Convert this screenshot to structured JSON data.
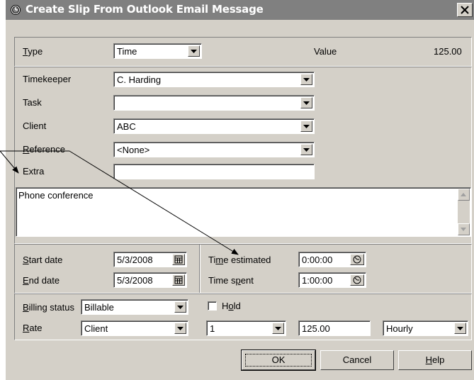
{
  "window": {
    "title": "Create Slip From Outlook Email Message"
  },
  "header": {
    "type_label": "Type",
    "type_value": "Time",
    "value_label": "Value",
    "value_amount": "125.00"
  },
  "fields": {
    "timekeeper_label": "Timekeeper",
    "timekeeper_value": "C. Harding",
    "task_label": "Task",
    "task_value": "",
    "client_label": "Client",
    "client_value": "ABC",
    "reference_label": "Reference",
    "reference_value": "<None>",
    "extra_label": "Extra",
    "extra_value": ""
  },
  "description": "Phone conference",
  "dates": {
    "start_label": "Start date",
    "start_value": "5/3/2008",
    "end_label": "End date",
    "end_value": "5/3/2008",
    "estimated_label": "Time estimated",
    "estimated_value": "0:00:00",
    "spent_label": "Time spent",
    "spent_value": "1:00:00"
  },
  "billing": {
    "status_label": "Billing status",
    "status_value": "Billable",
    "hold_label": "Hold",
    "hold_checked": false,
    "rate_label": "Rate",
    "rate_source": "Client",
    "rate_level": "1",
    "rate_amount": "125.00",
    "rate_unit": "Hourly"
  },
  "buttons": {
    "ok": "OK",
    "cancel": "Cancel",
    "help": "Help"
  },
  "icons": [
    "clock-icon",
    "close-icon",
    "dropdown-arrow-icon",
    "calendar-icon",
    "timer-icon",
    "scroll-up-icon",
    "scroll-down-icon"
  ]
}
